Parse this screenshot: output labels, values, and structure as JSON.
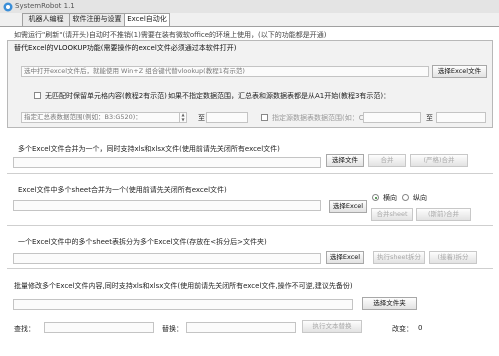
{
  "window": {
    "title": "SystemRobot 1.1"
  },
  "tabs": [
    "机器人编程",
    "软件注册与设置",
    "Excel自动化"
  ],
  "notice": "如需运行\"刷新\"(请开头)自动时不推销(1)需要在装有微软office的环境上使用，(以下的功能都是开通)",
  "vlookup": {
    "title": "替代Excel的VLOOKUP功能(需要操作的excel文件必须通过本软件打开)",
    "file_placeholder": "选中打开excel文件后，就能使用 Win+Z 组合键代替vlookup(教程1有示范)",
    "select_button": "选择Excel文件",
    "checkbox_label": "无匹配时保留单元格内容(教程2有示范)",
    "range_hint": "如果不指定数据范围，汇总表和源数据表都是从A1开始(教程3有示范)：",
    "summary_placeholder": "指定汇总表数据范围(例如：B3:G520)：",
    "summary_to": "至",
    "source_checkbox_label": "指定源数据表数据范围(如：C3:H49)：",
    "source_to": "至"
  },
  "merge_files": {
    "title": "多个Excel文件合并为一个，同时支持xls和xlsx文件(使用前请先关闭所有excel文件)",
    "select_button": "选择文件",
    "merge_button": "合并",
    "strict_merge_button": "(严格)合并"
  },
  "merge_sheets": {
    "title": "Excel文件中多个sheet合并为一个(使用前请先关闭所有excel文件)",
    "select_button": "选择Excel",
    "radio_horizontal": "横向",
    "radio_vertical": "纵向",
    "merge_button": "合并sheet",
    "strict_merge_button": "(斯前)合并"
  },
  "split_sheets": {
    "title": "一个Excel文件中的多个sheet表拆分为多个Excel文件(存放在<拆分后>文件夹)",
    "select_button": "选择Excel",
    "split_button": "执行sheet拆分",
    "open_button": "(接着)拆分"
  },
  "batch_replace": {
    "title": "批量修改多个Excel文件内容,同时支持xls和xlsx文件(使用前请先关闭所有excel文件,操作不可逆,建议先备份)",
    "select_button": "选择文件夹",
    "find_label": "查找：",
    "replace_label": "替换：",
    "execute_button": "执行文本替换",
    "count_label": "改变：",
    "count_value": "0"
  }
}
